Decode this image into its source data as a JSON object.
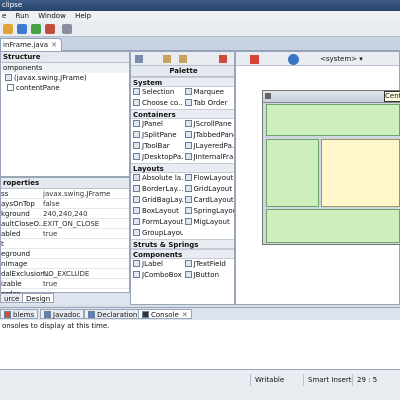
{
  "window": {
    "title": "clipse"
  },
  "menu": {
    "items": [
      "e",
      "Run",
      "Window",
      "Help"
    ]
  },
  "editor": {
    "tab_label": "inFrame.java"
  },
  "structure": {
    "title": "Structure",
    "components_label": "omponents",
    "tree": [
      "(javax.swing.JFrame)",
      "contentPane"
    ]
  },
  "properties": {
    "title": "roperties",
    "rows": [
      {
        "name": "ss",
        "value": "javax.swing.JFrame"
      },
      {
        "name": "aysOnTop",
        "value": "false"
      },
      {
        "name": "kground",
        "value": "240,240,240"
      },
      {
        "name": "aultCloseO...",
        "value": "EXIT_ON_CLOSE"
      },
      {
        "name": "abled",
        "value": "true"
      },
      {
        "name": "t",
        "value": ""
      },
      {
        "name": "eground",
        "value": ""
      },
      {
        "name": "nImage",
        "value": ""
      },
      {
        "name": "dalExclusion...",
        "value": "NO_EXCLUDE"
      },
      {
        "name": "izable",
        "value": "true"
      },
      {
        "name": "order",
        "value": ""
      }
    ]
  },
  "view_tabs": {
    "source": "urce",
    "design": "Design"
  },
  "palette": {
    "title": "Palette",
    "categories": [
      {
        "name": "System",
        "items": [
          "Selection",
          "Marquee",
          "Choose co...",
          "Tab Order"
        ]
      },
      {
        "name": "Containers",
        "items": [
          "JPanel",
          "JScrollPane",
          "JSplitPane",
          "JTabbedPane",
          "JToolBar",
          "JLayeredPa...",
          "JDesktopPa...",
          "JInternalFra..."
        ]
      },
      {
        "name": "Layouts",
        "items": [
          "Absolute la...",
          "FlowLayout",
          "BorderLay...",
          "GridLayout",
          "GridBagLay...",
          "CardLayout",
          "BoxLayout",
          "SpringLayout",
          "FormLayout",
          "MigLayout",
          "GroupLayout",
          ""
        ]
      },
      {
        "name": "Struts & Springs",
        "items": []
      },
      {
        "name": "Components",
        "items": [
          "JLabel",
          "JTextField",
          "JComboBox",
          "JButton"
        ]
      }
    ]
  },
  "design_toolbar": {
    "system_label": "<system>"
  },
  "design": {
    "tooltip": "Center"
  },
  "bottom_tabs": [
    "blems",
    "Javadoc",
    "Declaration",
    "Console"
  ],
  "console": {
    "message": "onsoles to display at this time."
  },
  "status": {
    "mode": "Writable",
    "insert": "Smart Insert",
    "position": "29 : 5"
  },
  "colors": {
    "panel_green": "#cfeebd",
    "panel_yellow": "#fff6c9",
    "title_blue": "#2a456b"
  }
}
